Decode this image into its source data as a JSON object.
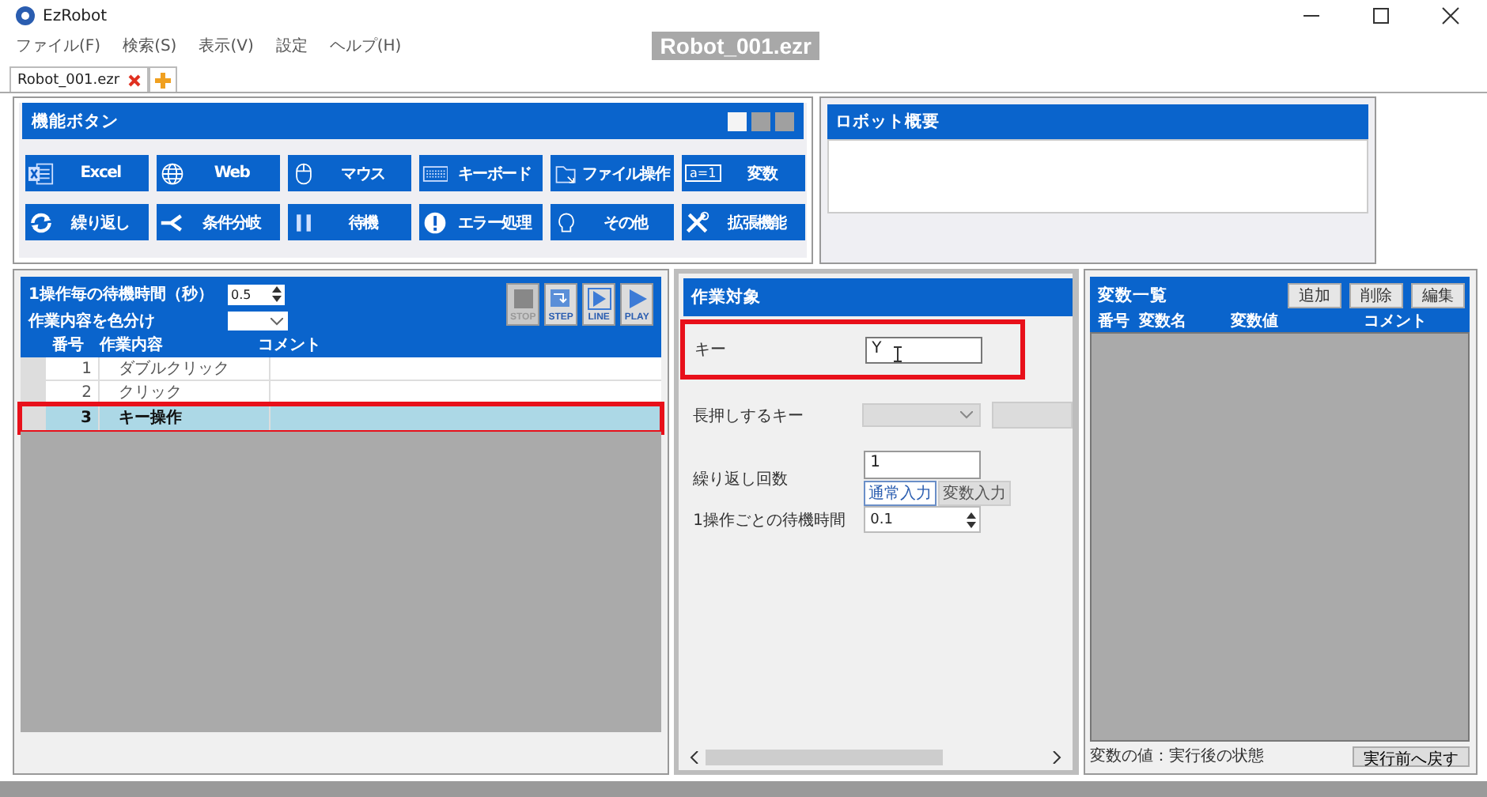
{
  "window": {
    "title": "EzRobot"
  },
  "menu": [
    "ファイル(F)",
    "検索(S)",
    "表示(V)",
    "設定",
    "ヘルプ(H)"
  ],
  "file_label": "Robot_001.ezr",
  "tabs": [
    {
      "label": "Robot_001.ezr",
      "selected": true
    }
  ],
  "function_panel": {
    "title": "機能ボタン",
    "view_toggles": [
      {
        "selected": true
      },
      {
        "selected": false
      },
      {
        "selected": false
      }
    ],
    "buttons": [
      {
        "label": "Excel"
      },
      {
        "label": "Web"
      },
      {
        "label": "マウス"
      },
      {
        "label": "キーボード"
      },
      {
        "label": "ファイル操作"
      },
      {
        "label": "変数",
        "icon_text": "a=1"
      },
      {
        "label": "繰り返し"
      },
      {
        "label": "条件分岐"
      },
      {
        "label": "待機"
      },
      {
        "label": "エラー処理"
      },
      {
        "label": "その他"
      },
      {
        "label": "拡張機能"
      }
    ]
  },
  "robot_summary": {
    "title": "ロボット概要"
  },
  "sequence": {
    "wait_label": "1操作毎の待機時間（秒）",
    "wait_value": "0.5",
    "color_label": "作業内容を色分け",
    "controls": [
      {
        "label": "STOP",
        "disabled": true
      },
      {
        "label": "STEP",
        "disabled": false
      },
      {
        "label": "LINE",
        "disabled": false
      },
      {
        "label": "PLAY",
        "disabled": false
      }
    ],
    "columns": [
      "番号",
      "作業内容",
      "コメント"
    ],
    "rows": [
      {
        "number": "1",
        "action": "ダブルクリック",
        "selected": false,
        "highlighted": false
      },
      {
        "number": "2",
        "action": "クリック",
        "selected": false,
        "highlighted": false
      },
      {
        "number": "3",
        "action": "キー操作",
        "selected": true,
        "highlighted": true
      }
    ]
  },
  "target": {
    "title": "作業対象",
    "key_label": "キー",
    "key_value": "Y",
    "key_highlighted": true,
    "hold_label": "長押しするキー",
    "repeat_label": "繰り返し回数",
    "repeat_value": "1",
    "input_modes": [
      {
        "label": "通常入力",
        "selected": true
      },
      {
        "label": "変数入力",
        "selected": false
      }
    ],
    "wait_label": "1操作ごとの待機時間",
    "wait_value": "0.1"
  },
  "variables": {
    "title": "変数一覧",
    "buttons": [
      "追加",
      "削除",
      "編集"
    ],
    "columns": [
      "番号",
      "変数名",
      "変数値",
      "コメント"
    ],
    "footer": "変数の値：実行後の状態",
    "reset_button": "実行前へ戻す"
  }
}
